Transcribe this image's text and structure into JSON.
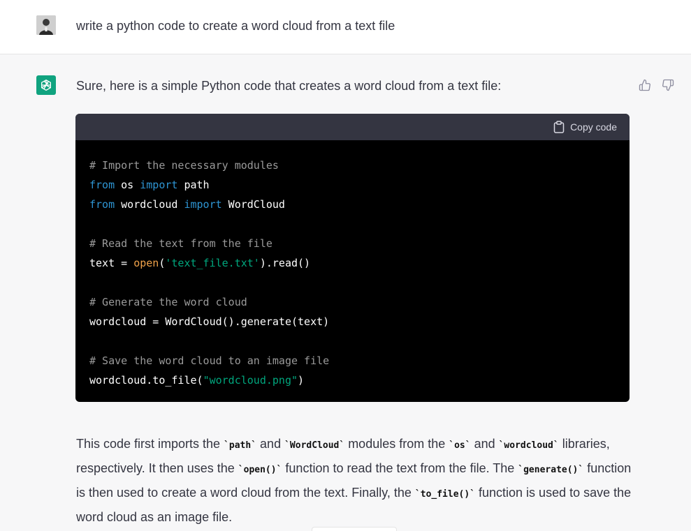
{
  "user_message": {
    "text": "write a python code to create a word cloud from a text file",
    "avatar_icon": "user-photo-avatar"
  },
  "assistant_message": {
    "intro": "Sure, here is a simple Python code that creates a word cloud from a text file:",
    "avatar_icon": "openai-logo-icon",
    "avatar_color": "#10a37f",
    "feedback": {
      "thumbs_up_icon": "thumbs-up-icon",
      "thumbs_down_icon": "thumbs-down-icon"
    },
    "code_block": {
      "copy_label": "Copy code",
      "copy_icon": "clipboard-icon",
      "lines": [
        "# Import the necessary modules",
        "from os import path",
        "from wordcloud import WordCloud",
        "",
        "# Read the text from the file",
        "text = open('text_file.txt').read()",
        "",
        "# Generate the word cloud",
        "wordcloud = WordCloud().generate(text)",
        "",
        "# Save the word cloud to an image file",
        "wordcloud.to_file(\"wordcloud.png\")"
      ],
      "tokens": {
        "l0": "# Import the necessary modules",
        "l1_from": "from",
        "l1_mod": " os ",
        "l1_import": "import",
        "l1_name": " path",
        "l2_from": "from",
        "l2_mod": " wordcloud ",
        "l2_import": "import",
        "l2_name": " WordCloud",
        "l4": "# Read the text from the file",
        "l5_a": "text = ",
        "l5_open": "open",
        "l5_b": "(",
        "l5_str": "'text_file.txt'",
        "l5_c": ").read()",
        "l7": "# Generate the word cloud",
        "l8": "wordcloud = WordCloud().generate(text)",
        "l10": "# Save the word cloud to an image file",
        "l11_a": "wordcloud.to_file(",
        "l11_str": "\"wordcloud.png\"",
        "l11_b": ")"
      }
    },
    "explanation": {
      "s1": "This code first imports the ",
      "c1": "`path`",
      "s2": " and ",
      "c2": "`WordCloud`",
      "s3": " modules from the ",
      "c3": "`os`",
      "s4": " and ",
      "c4": "`wordcloud`",
      "s5": " libraries, respectively. It then uses the ",
      "c5": "`open()`",
      "s6": " function to read the text from the file. The ",
      "c6": "`generate()`",
      "s7": " function is then used to create a word cloud from the text. Finally, the ",
      "c7": "`to_file()`",
      "s8": " function is used to save the word cloud as an image file."
    }
  }
}
